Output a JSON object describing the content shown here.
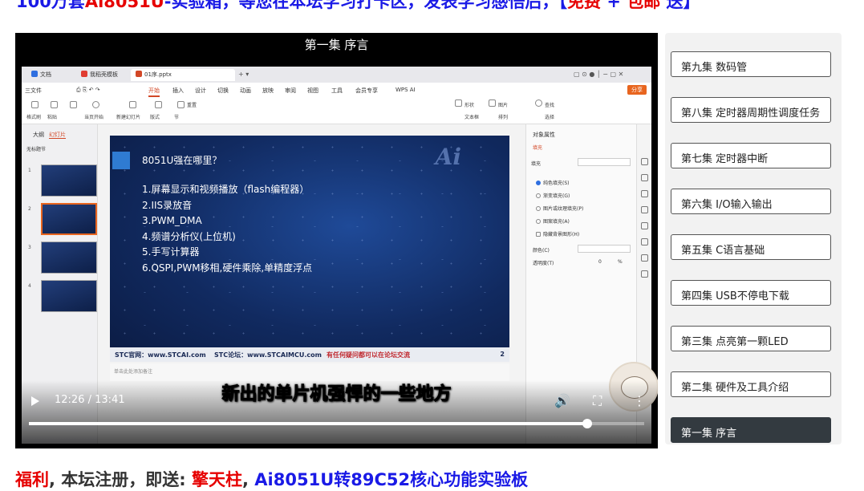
{
  "banner": {
    "part1": "100万套",
    "part2": "Ai8051U",
    "part3": "-实验箱，等您在本坛学习打卡区，发表学习感悟后，【",
    "part4": "免费",
    "part5": " + ",
    "part6": "包邮",
    "part7": " 送】"
  },
  "player": {
    "title": "第一集 序言",
    "current_time": "12:26",
    "separator": " / ",
    "duration": "13:41",
    "progress_fraction": 0.908,
    "subtitle": "新出的单片机强悍的一些地方",
    "controls": {
      "volume": "volume-icon",
      "fullscreen": "fullscreen-icon",
      "more": "more-icon"
    }
  },
  "screen": {
    "tabs": [
      {
        "label": "文档",
        "color": "#2f6fe0"
      },
      {
        "label": "我稻壳模板",
        "color": "#e03c31"
      },
      {
        "label": "01序.pptx",
        "color": "#d24726"
      }
    ],
    "menu": [
      "三文件",
      "开始",
      "插入",
      "设计",
      "切换",
      "动画",
      "放映",
      "审阅",
      "视图",
      "工具",
      "会员专享",
      "WPS AI"
    ],
    "menu_active": "开始",
    "share": "分享",
    "ribbon_labels": [
      "格式刷",
      "粘贴",
      "当页开始",
      "新建幻灯片",
      "版式",
      "节",
      "重置",
      "形状",
      "图片",
      "查找",
      "文本框",
      "排列",
      "选择"
    ],
    "left_tabs": {
      "outline": "大纲",
      "slides": "幻灯片"
    },
    "section": "无标题节",
    "slide_numbers": [
      "1",
      "2",
      "3",
      "4"
    ],
    "slide": {
      "heading": "8051U强在哪里？",
      "logo": "Ai",
      "items": [
        "1.屏幕显示和视频播放（flash编程器）",
        "2.IIS录放音",
        "3.PWM_DMA",
        "4.频谱分析仪(上位机)",
        "5.手写计算器",
        "6.QSPI,PWM移相,硬件乘除,单精度浮点"
      ],
      "footer": {
        "site": "STC官网：www.STCAI.com",
        "forum": "STC论坛：www.STCAIMCU.com",
        "note": "有任何疑问都可以在论坛交流",
        "page": "2"
      }
    },
    "notes_placeholder": "单击此处添加备注",
    "props": {
      "title": "对象属性",
      "fill_tab": "填充",
      "fill_label": "填充",
      "options": [
        "纯色填充(S)",
        "渐变填充(G)",
        "图片或纹理填充(P)",
        "图案填充(A)",
        "隐藏背景图形(H)"
      ],
      "color_label": "颜色(C)",
      "transparency_label": "透明度(T)",
      "transparency_value": "0",
      "percent": "%"
    }
  },
  "playlist": [
    {
      "label": "第九集 数码管",
      "current": false
    },
    {
      "label": "第八集 定时器周期性调度任务",
      "current": false
    },
    {
      "label": "第七集 定时器中断",
      "current": false
    },
    {
      "label": "第六集 I/O输入输出",
      "current": false
    },
    {
      "label": "第五集 C语言基础",
      "current": false
    },
    {
      "label": "第四集 USB不停电下载",
      "current": false
    },
    {
      "label": "第三集 点亮第一颗LED",
      "current": false
    },
    {
      "label": "第二集 硬件及工具介绍",
      "current": false
    },
    {
      "label": "第一集 序言",
      "current": true
    }
  ],
  "bottom": {
    "part1": "福利",
    "part2": ", 本坛注册，即送: ",
    "part3": "擎天柱",
    "part4": ", ",
    "part5": "Ai8051U转89C52核心功能实验板"
  }
}
